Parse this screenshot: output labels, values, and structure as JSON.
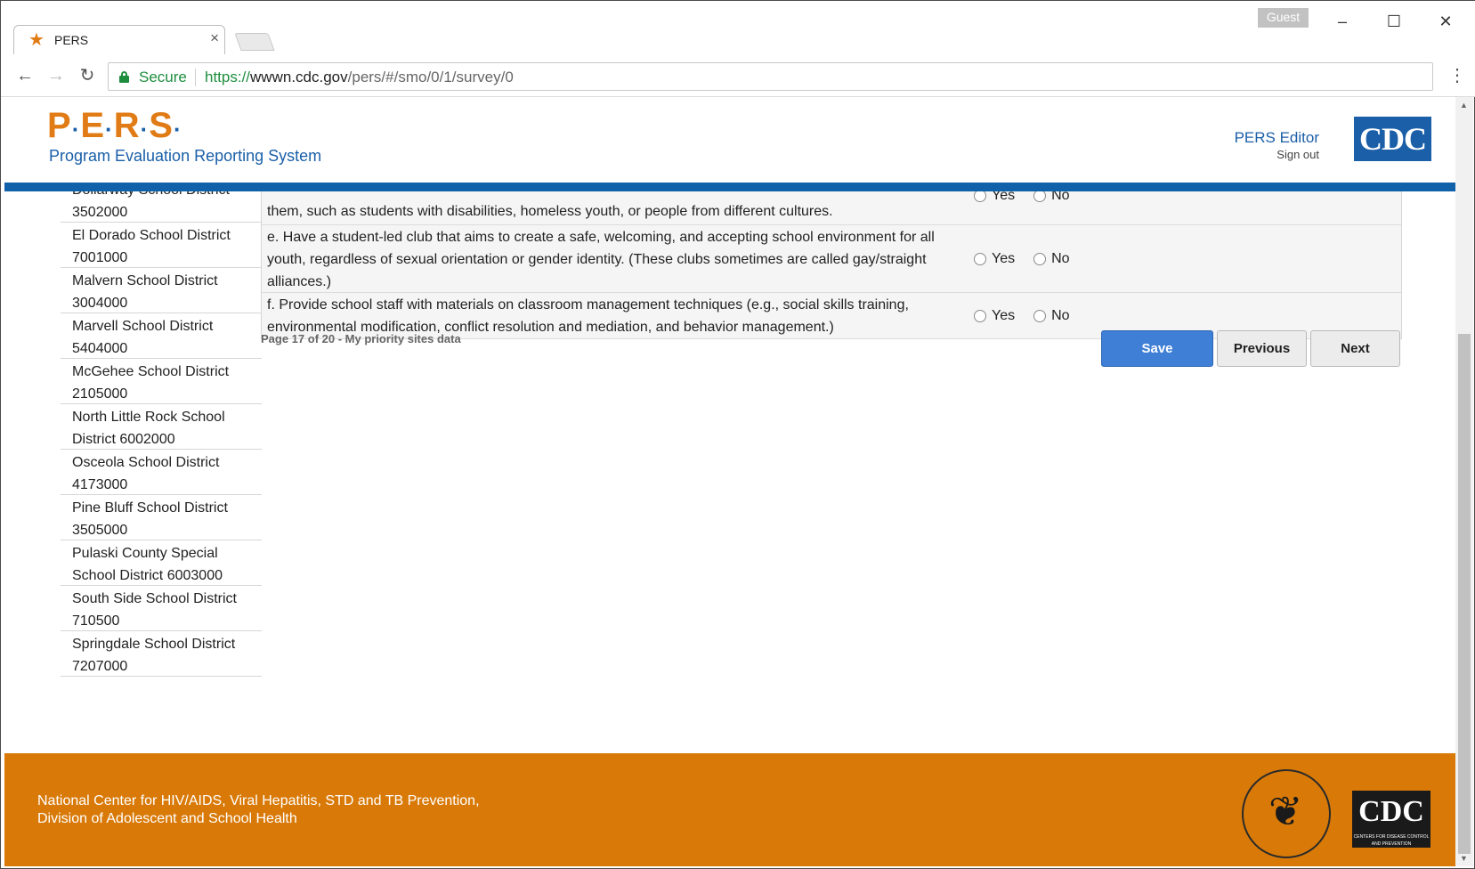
{
  "browser": {
    "tab_title": "PERS",
    "guest_label": "Guest",
    "secure_label": "Secure",
    "url_prefix": "https://",
    "url_domain": "wwwn.cdc.gov",
    "url_path": "/pers/#/smo/0/1/survey/0"
  },
  "header": {
    "logo_letters": [
      "P",
      "E",
      "R",
      "S"
    ],
    "logo_subtitle": "Program Evaluation Reporting System",
    "editor_label": "PERS Editor",
    "signout_label": "Sign out",
    "cdc_logo_text": "CDC"
  },
  "sidebar": {
    "items": [
      {
        "name": "Dollarway School District",
        "code": "3502000"
      },
      {
        "name": "El Dorado School District",
        "code": "7001000"
      },
      {
        "name": "Malvern School District",
        "code": "3004000"
      },
      {
        "name": "Marvell School District",
        "code": "5404000"
      },
      {
        "name": "McGehee School District",
        "code": "2105000"
      },
      {
        "name": "North Little Rock School",
        "code": "District 6002000"
      },
      {
        "name": "Osceola School District",
        "code": "4173000"
      },
      {
        "name": "Pine Bluff School District",
        "code": "3505000"
      },
      {
        "name": "Pulaski County Special",
        "code": "School District 6003000"
      },
      {
        "name": "South Side School District",
        "code": "710500"
      },
      {
        "name": "Springdale School District",
        "code": "7207000"
      }
    ]
  },
  "questions": [
    {
      "text": "them, such as students with disabilities, homeless youth, or people from different cultures.",
      "yes": "Yes",
      "no": "No"
    },
    {
      "text": "e. Have a student-led club that aims to create a safe, welcoming, and accepting school environment for all youth, regardless of sexual orientation or gender identity. (These clubs sometimes are called gay/straight alliances.)",
      "yes": "Yes",
      "no": "No"
    },
    {
      "text": "f. Provide school staff with materials on classroom management techniques (e.g., social skills training, environmental modification, conflict resolution and mediation, and behavior management.)",
      "yes": "Yes",
      "no": "No"
    }
  ],
  "pager": {
    "info": "Page 17 of 20 - My priority sites data",
    "save_label": "Save",
    "previous_label": "Previous",
    "next_label": "Next"
  },
  "footer": {
    "line1": "National Center for HIV/AIDS, Viral Hepatitis, STD and TB Prevention,",
    "line2": "Division of Adolescent and School Health",
    "cdc_text": "CDC",
    "cdc_sub": "CENTERS FOR DISEASE CONTROL AND PREVENTION"
  },
  "colors": {
    "brand_orange": "#e07b15",
    "brand_blue": "#1a5fa8",
    "footer_orange": "#d97a08",
    "save_blue": "#3f7fd5"
  }
}
